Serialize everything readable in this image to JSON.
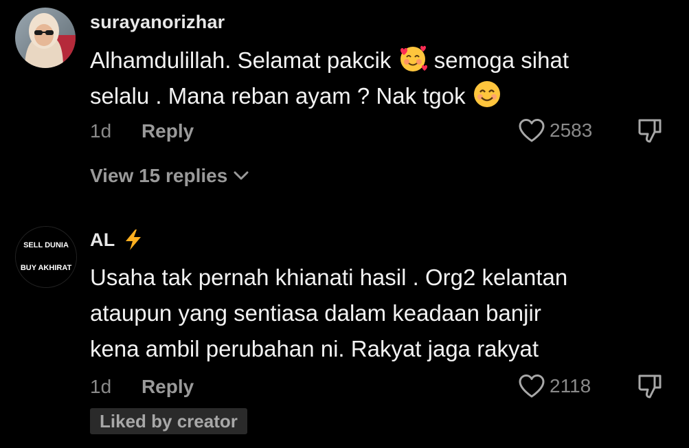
{
  "comments": [
    {
      "username": "surayanorizhar",
      "lines": [
        {
          "before": "Alhamdulillah. Selamat pakcik ",
          "emoji": "smiling-face-with-hearts",
          "after": " semoga sihat"
        },
        {
          "before": "selalu . Mana reban ayam ? Nak tgok ",
          "emoji": "smiling-face-with-smiling-eyes",
          "after": ""
        }
      ],
      "timestamp": "1d",
      "reply_label": "Reply",
      "like_count": "2583",
      "view_replies_label": "View 15 replies"
    },
    {
      "username": "AL",
      "username_emoji": "lightning-emoji",
      "avatar_text_top": "SELL DUNIA",
      "avatar_text_bottom": "BUY AKHIRAT",
      "lines": [
        {
          "before": "Usaha tak pernah khianati hasil . Org2 kelantan"
        },
        {
          "before": "ataupun yang sentiasa dalam keadaan banjir"
        },
        {
          "before": "kena ambil perubahan ni. Rakyat jaga rakyat"
        }
      ],
      "timestamp": "1d",
      "reply_label": "Reply",
      "like_count": "2118",
      "liked_badge": "Liked by creator"
    }
  ],
  "colors": {
    "background": "#000000",
    "text_primary": "#f2f2f2",
    "text_secondary": "#8a8a8a",
    "badge_bg": "#2a2a2a"
  }
}
